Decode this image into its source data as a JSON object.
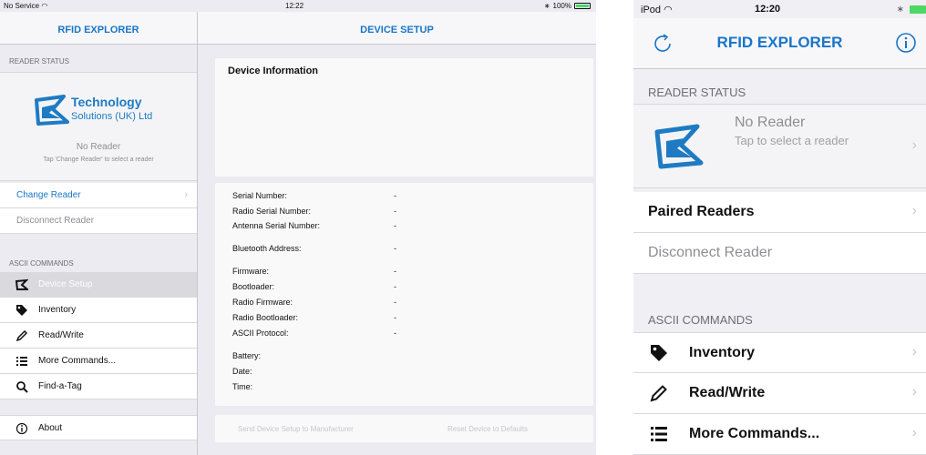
{
  "ipad": {
    "status": {
      "carrier": "No Service",
      "time": "12:22",
      "battery": "100%"
    },
    "master_title": "RFID EXPLORER",
    "detail_title": "DEVICE SETUP",
    "reader_status_header": "READER STATUS",
    "logo": {
      "line1": "Technology",
      "line2": "Solutions (UK) Ltd"
    },
    "reader": {
      "name": "No Reader",
      "hint": "Tap 'Change Reader' to select a reader"
    },
    "change_reader": "Change Reader",
    "disconnect_reader": "Disconnect Reader",
    "ascii_header": "ASCII COMMANDS",
    "commands": [
      {
        "label": "Device Setup",
        "icon": "device-setup-icon"
      },
      {
        "label": "Inventory",
        "icon": "tag-icon"
      },
      {
        "label": "Read/Write",
        "icon": "pencil-icon"
      },
      {
        "label": "More Commands...",
        "icon": "list-icon"
      },
      {
        "label": "Find-a-Tag",
        "icon": "magnifier-icon"
      }
    ],
    "about": "About",
    "device_info_title": "Device Information",
    "info_rows": [
      {
        "label": "Serial Number:",
        "value": "-"
      },
      {
        "label": "Radio Serial Number:",
        "value": "-"
      },
      {
        "label": "Antenna Serial Number:",
        "value": "-"
      },
      {
        "label": "Bluetooth Address:",
        "value": "-"
      },
      {
        "label": "Firmware:",
        "value": "-"
      },
      {
        "label": "Bootloader:",
        "value": "-"
      },
      {
        "label": "Radio Firmware:",
        "value": "-"
      },
      {
        "label": "Radio Bootloader:",
        "value": "-"
      },
      {
        "label": "ASCII Protocol:",
        "value": "-"
      },
      {
        "label": "Battery:",
        "value": ""
      },
      {
        "label": "Date:",
        "value": ""
      },
      {
        "label": "Time:",
        "value": ""
      }
    ],
    "send_setup": "Send Device Setup to Manufacturer",
    "reset_device": "Reset Device to Defaults"
  },
  "iphone": {
    "status": {
      "carrier": "iPod",
      "time": "12:20"
    },
    "title": "RFID EXPLORER",
    "reader_status_header": "READER STATUS",
    "reader": {
      "name": "No Reader",
      "hint": "Tap to select a reader"
    },
    "paired_readers": "Paired Readers",
    "disconnect_reader": "Disconnect Reader",
    "ascii_header": "ASCII COMMANDS",
    "commands": [
      {
        "label": "Inventory",
        "icon": "tag-icon"
      },
      {
        "label": "Read/Write",
        "icon": "pencil-icon"
      },
      {
        "label": "More Commands...",
        "icon": "list-icon"
      }
    ]
  },
  "colors": {
    "accent": "#1a75c9",
    "logo_blue": "#1e7bc3",
    "battery_green": "#4cd964"
  }
}
